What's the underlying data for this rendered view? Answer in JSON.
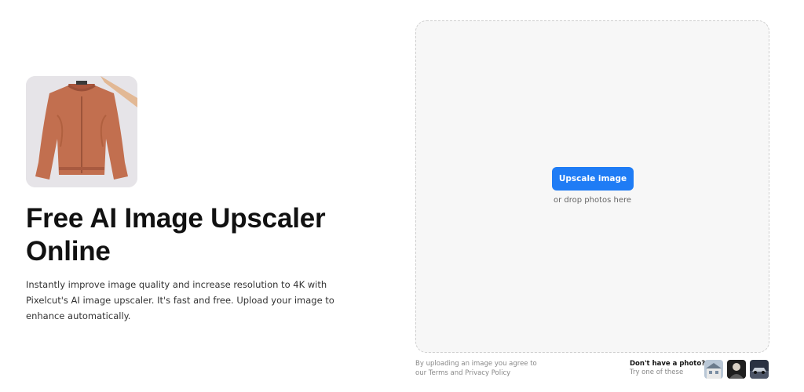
{
  "hero": {
    "image": "jacket-photo",
    "title": "Free AI Image Upscaler Online",
    "description": "Instantly improve image quality and increase resolution to 4K with Pixelcut's AI image upscaler. It's fast and free. Upload your image to enhance automatically."
  },
  "upload": {
    "button_label": "Upscale image",
    "drop_hint": "or drop photos here"
  },
  "terms": {
    "prefix": "By uploading an image you agree to our ",
    "terms_link": "Terms",
    "and": " and ",
    "privacy_link": "Privacy Policy"
  },
  "samples": {
    "title": "Don't have a photo?",
    "subtitle": "Try one of these",
    "images": [
      "house-sample",
      "portrait-sample",
      "car-sample"
    ]
  },
  "colors": {
    "accent": "#1f7cf5",
    "dropzone_bg": "#f7f7f7"
  }
}
